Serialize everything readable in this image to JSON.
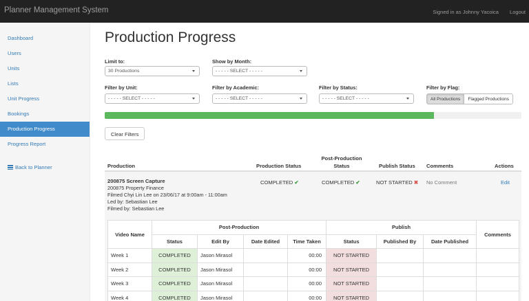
{
  "app": {
    "title": "Planner Management System",
    "signed_in": "Signed in as Johnny Yacoica",
    "logout": "Logout"
  },
  "sidebar": {
    "items": [
      {
        "label": "Dashboard"
      },
      {
        "label": "Users"
      },
      {
        "label": "Units"
      },
      {
        "label": "Lists"
      },
      {
        "label": "Unit Progress"
      },
      {
        "label": "Bookings"
      },
      {
        "label": "Production Progress",
        "active": true
      },
      {
        "label": "Progress Report"
      }
    ],
    "back_label": "Back to Planner",
    "back_icon": "list-grid-icon"
  },
  "page": {
    "title": "Production Progress"
  },
  "filters": {
    "limit": {
      "label": "Limit to:",
      "value": "30 Productions"
    },
    "month": {
      "label": "Show by Month:",
      "value": "- - - - - SELECT - - - - -"
    },
    "unit": {
      "label": "Filter by Unit:",
      "value": "- - - - - SELECT - - - - -"
    },
    "academic": {
      "label": "Filter by Academic:",
      "value": "- - - - - SELECT - - - - -"
    },
    "status": {
      "label": "Filter by Status:",
      "value": "- - - - - SELECT - - - - -"
    },
    "flag": {
      "label": "Filter by Flag:",
      "all": "All Productions",
      "flagged": "Flagged Productions",
      "selected": "All Productions"
    },
    "clear": "Clear Filters"
  },
  "progress": {
    "fraction": 0.79,
    "color": "#5cb85c"
  },
  "table": {
    "headers": {
      "production": "Production",
      "production_status": "Production Status",
      "post_production_status": "Post-Production Status",
      "publish_status": "Publish Status",
      "comments": "Comments",
      "actions": "Actions"
    },
    "rows": [
      {
        "title": "200875 Screen Capture",
        "line1": "200875 Property Finance",
        "line2": "Filmed Chyi Lin Lee on 23/06/17 at 9:00am - 11:00am",
        "line3": "Led by: Sebastian Lee",
        "line4": "Filmed by: Sebastian Lee",
        "production_status": "COMPLETED",
        "post_production_status": "COMPLETED",
        "publish_status": "NOT STARTED",
        "comment": "No Comment",
        "action": "Edit",
        "videos_header": {
          "video_name": "Video Name",
          "post_production": "Post-Production",
          "publish": "Publish",
          "comments": "Comments",
          "status": "Status",
          "edit_by": "Edit By",
          "date_edited": "Date Edited",
          "time_taken": "Time Taken",
          "pub_status": "Status",
          "published_by": "Published By",
          "date_published": "Date Published"
        },
        "videos": [
          {
            "name": "Week 1",
            "status": "COMPLETED",
            "edit_by": "Jason Mirasol",
            "date_edited": "",
            "time_taken": "00:00",
            "pub_status": "NOT STARTED",
            "published_by": "",
            "date_published": "",
            "comments": ""
          },
          {
            "name": "Week 2",
            "status": "COMPLETED",
            "edit_by": "Jason Mirasol",
            "date_edited": "",
            "time_taken": "00:00",
            "pub_status": "NOT STARTED",
            "published_by": "",
            "date_published": "",
            "comments": ""
          },
          {
            "name": "Week 3",
            "status": "COMPLETED",
            "edit_by": "Jason Mirasol",
            "date_edited": "",
            "time_taken": "00:00",
            "pub_status": "NOT STARTED",
            "published_by": "",
            "date_published": "",
            "comments": ""
          },
          {
            "name": "Week 4",
            "status": "COMPLETED",
            "edit_by": "Jason Mirasol",
            "date_edited": "",
            "time_taken": "00:00",
            "pub_status": "NOT STARTED",
            "published_by": "",
            "date_published": "",
            "comments": ""
          }
        ]
      }
    ]
  },
  "colors": {
    "accent": "#428bca",
    "topbar": "#222222",
    "success": "#5cb85c",
    "danger": "#d9534f",
    "link": "#337ab7"
  }
}
